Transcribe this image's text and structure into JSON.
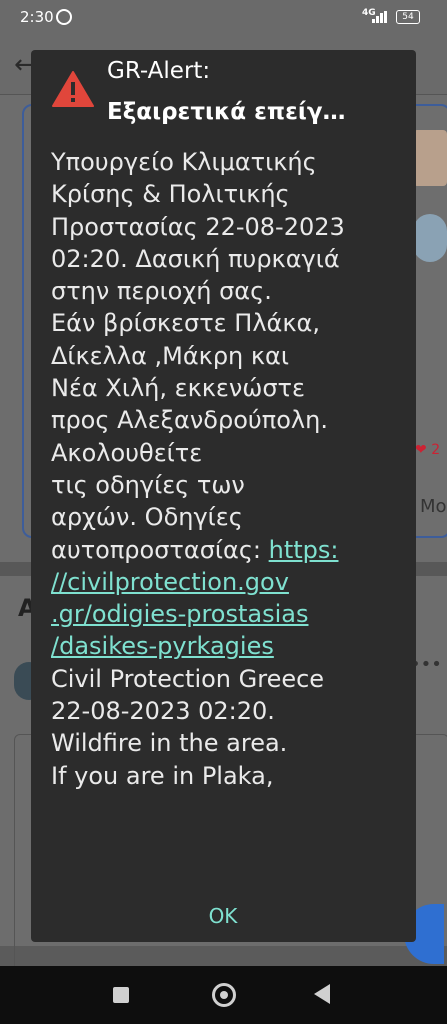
{
  "status_bar": {
    "time": "2:30",
    "network": "4G",
    "battery": "54"
  },
  "background": {
    "section_letter": "A",
    "partial_text": "Mo",
    "reaction_count": "2"
  },
  "alert": {
    "title": "GR-Alert:",
    "subtitle": "Εξαιρετικά επείγ…",
    "icon": "warning-triangle-icon",
    "icon_color": "#e0463b",
    "body_lines": [
      "Υπουργείο Κλιματικής",
      "Κρίσης & Πολιτικής",
      "Προστασίας 22-08-2023",
      "02:20. Δασική πυρκαγιά",
      "στην περιοχή σας.",
      "Εάν βρίσκεστε Πλάκα,",
      "Δίκελλα ,Μάκρη και",
      "Νέα Χιλή, εκκενώστε",
      "προς Αλεξανδρούπολη.",
      "Ακολουθείτε",
      "τις οδηγίες των",
      "αρχών. Οδηγίες",
      "αυτοπροστασίας: "
    ],
    "link_lines": [
      "https:",
      "//civilprotection.gov",
      ".gr/odigies-prostasias",
      "/dasikes-pyrkagies"
    ],
    "body_lines_en": [
      "Civil Protection Greece",
      "22-08-2023 02:20.",
      "Wildfire in the area.",
      "If you are in Plaka,"
    ],
    "ok_label": "OK",
    "link_color": "#7fe1d0"
  },
  "nav": {
    "recents": "square-icon",
    "home": "circle-icon",
    "back": "triangle-back-icon"
  }
}
